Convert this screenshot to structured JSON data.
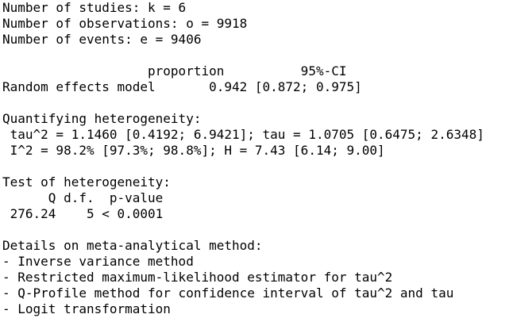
{
  "console": {
    "lines": [
      "Number of studies: k = 6",
      "Number of observations: o = 9918",
      "Number of events: e = 9406",
      "",
      "                   proportion          95%-CI",
      "Random effects model       0.942 [0.872; 0.975]",
      "",
      "Quantifying heterogeneity:",
      " tau^2 = 1.1460 [0.4192; 6.9421]; tau = 1.0705 [0.6475; 2.6348]",
      " I^2 = 98.2% [97.3%; 98.8%]; H = 7.43 [6.14; 9.00]",
      "",
      "Test of heterogeneity:",
      "      Q d.f.  p-value",
      " 276.24    5 < 0.0001",
      "",
      "Details on meta-analytical method:",
      "- Inverse variance method",
      "- Restricted maximum-likelihood estimator for tau^2",
      "- Q-Profile method for confidence interval of tau^2 and tau",
      "- Logit transformation"
    ]
  }
}
